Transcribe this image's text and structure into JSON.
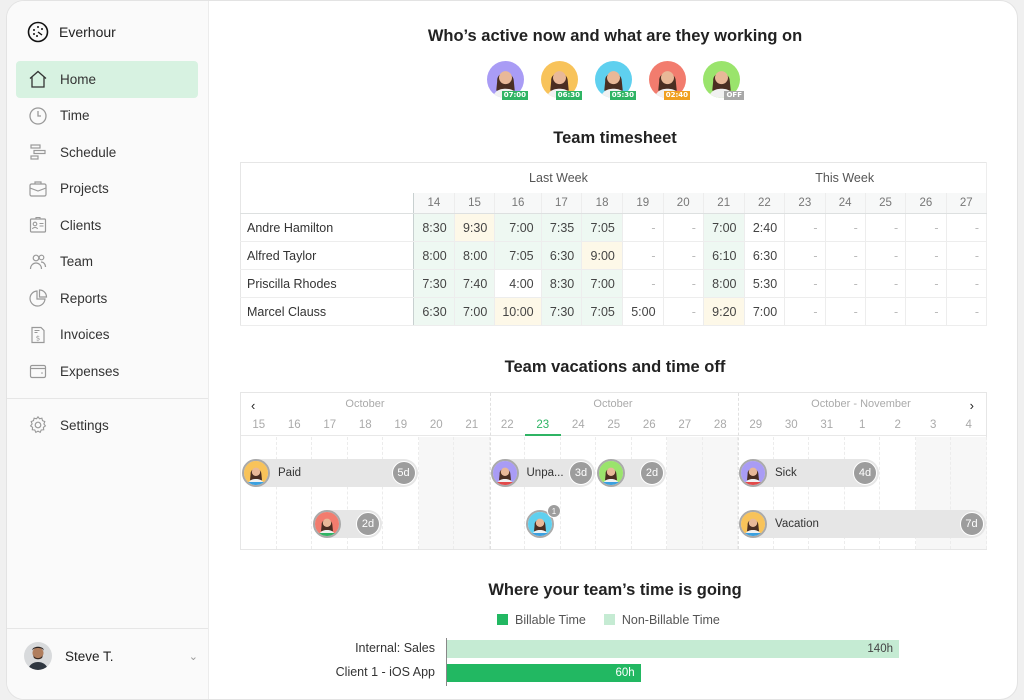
{
  "app": {
    "name": "Everhour"
  },
  "sidebar": {
    "items": [
      {
        "label": "Home",
        "icon": "home-icon",
        "active": true
      },
      {
        "label": "Time",
        "icon": "clock-icon"
      },
      {
        "label": "Schedule",
        "icon": "schedule-icon"
      },
      {
        "label": "Projects",
        "icon": "briefcase-icon"
      },
      {
        "label": "Clients",
        "icon": "contact-card-icon"
      },
      {
        "label": "Team",
        "icon": "team-icon"
      },
      {
        "label": "Reports",
        "icon": "pie-chart-icon"
      },
      {
        "label": "Invoices",
        "icon": "invoice-icon"
      },
      {
        "label": "Expenses",
        "icon": "wallet-icon"
      }
    ],
    "settings": {
      "label": "Settings",
      "icon": "gear-icon"
    },
    "user": {
      "name": "Steve T."
    }
  },
  "active_now": {
    "title": "Who’s active now and what are they working on",
    "people": [
      {
        "badge": "07:00",
        "badge_color": "#2fb464",
        "bg": "#a99cf5"
      },
      {
        "badge": "06:30",
        "badge_color": "#2fb464",
        "bg": "#f8c35a"
      },
      {
        "badge": "05:30",
        "badge_color": "#2fb464",
        "bg": "#5fd0ef"
      },
      {
        "badge": "02:40",
        "badge_color": "#f0a020",
        "bg": "#f27c6e"
      },
      {
        "badge": "OFF",
        "badge_color": "#a8a8a8",
        "bg": "#9ae46c"
      }
    ]
  },
  "timesheet": {
    "title": "Team timesheet",
    "weeks": [
      "Last Week",
      "This Week"
    ],
    "days": [
      "14",
      "15",
      "16",
      "17",
      "18",
      "19",
      "20",
      "21",
      "22",
      "23",
      "24",
      "25",
      "26",
      "27"
    ],
    "rows": [
      {
        "name": "Andre Hamilton",
        "values": [
          "8:30",
          "9:30",
          "7:00",
          "7:35",
          "7:05",
          "-",
          "-",
          "7:00",
          "2:40",
          "-",
          "-",
          "-",
          "-",
          "-"
        ],
        "styles": [
          "g",
          "y",
          "g",
          "g",
          "g",
          "",
          "",
          "g",
          "",
          "",
          "",
          "",
          "",
          ""
        ]
      },
      {
        "name": "Alfred Taylor",
        "values": [
          "8:00",
          "8:00",
          "7:05",
          "6:30",
          "9:00",
          "-",
          "-",
          "6:10",
          "6:30",
          "-",
          "-",
          "-",
          "-",
          "-"
        ],
        "styles": [
          "g",
          "g",
          "g",
          "g",
          "y",
          "",
          "",
          "g",
          "",
          "",
          "",
          "",
          "",
          ""
        ]
      },
      {
        "name": "Priscilla Rhodes",
        "values": [
          "7:30",
          "7:40",
          "4:00",
          "8:30",
          "7:00",
          "-",
          "-",
          "8:00",
          "5:30",
          "-",
          "-",
          "-",
          "-",
          "-"
        ],
        "styles": [
          "g",
          "g",
          "",
          "g",
          "g",
          "",
          "",
          "g",
          "",
          "",
          "",
          "",
          "",
          ""
        ]
      },
      {
        "name": "Marcel Clauss",
        "values": [
          "6:30",
          "7:00",
          "10:00",
          "7:30",
          "7:05",
          "5:00",
          "-",
          "9:20",
          "7:00",
          "-",
          "-",
          "-",
          "-",
          "-"
        ],
        "styles": [
          "g",
          "g",
          "y",
          "g",
          "g",
          "",
          "",
          "y",
          "",
          "",
          "",
          "",
          "",
          ""
        ]
      }
    ]
  },
  "vacations": {
    "title": "Team vacations and time off",
    "months": [
      "October",
      "October",
      "October - November"
    ],
    "days": [
      "15",
      "16",
      "17",
      "18",
      "19",
      "20",
      "21",
      "22",
      "23",
      "24",
      "25",
      "26",
      "27",
      "28",
      "29",
      "30",
      "31",
      "1",
      "2",
      "3",
      "4"
    ],
    "today": "23",
    "weekend_days": [
      "20",
      "21",
      "27",
      "28",
      "3",
      "4"
    ],
    "entries": [
      {
        "label": "Paid",
        "days": "5d",
        "stripe": "#3aa0e0",
        "bg": "#f8c35a"
      },
      {
        "label": "",
        "days": "2d",
        "stripe": "#2fb464",
        "bg": "#f27c6e"
      },
      {
        "label": "Unpa...",
        "days": "3d",
        "stripe": "#e24a4a",
        "bg": "#a99cf5"
      },
      {
        "label": "",
        "days": "2d",
        "stripe": "#3aa0e0",
        "bg": "#9ae46c"
      },
      {
        "label": "",
        "count": "1",
        "stripe": "#3aa0e0",
        "bg": "#5fd0ef"
      },
      {
        "label": "Sick",
        "days": "4d",
        "stripe": "#e24a4a",
        "bg": "#a99cf5"
      },
      {
        "label": "Vacation",
        "days": "7d",
        "stripe": "#3aa0e0",
        "bg": "#f8c35a"
      }
    ]
  },
  "time_going": {
    "title": "Where your team’s time is going",
    "legend": [
      {
        "label": "Billable Time",
        "color": "#22b862"
      },
      {
        "label": "Non-Billable Time",
        "color": "#c5ebd3"
      }
    ],
    "bars": [
      {
        "label": "Internal: Sales",
        "value_label": "140h",
        "value": 140,
        "type": "non-billable"
      },
      {
        "label": "Client 1 - iOS App",
        "value_label": "60h",
        "value": 60,
        "type": "billable"
      }
    ]
  }
}
